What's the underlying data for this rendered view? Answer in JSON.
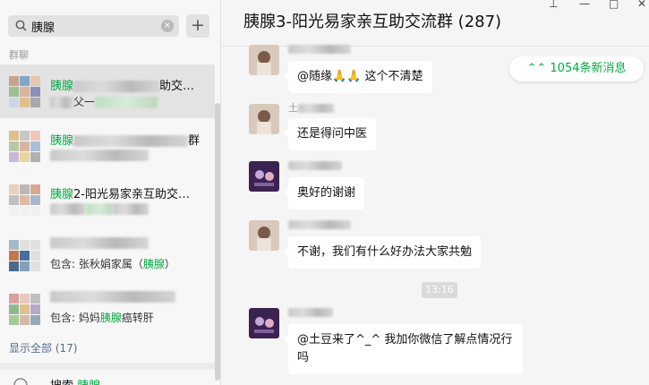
{
  "search": {
    "query": "胰腺",
    "clear_symbol": "×",
    "add_symbol": "+"
  },
  "results": {
    "section_label": "群聊",
    "items": [
      {
        "keyword": "胰腺",
        "title_tail": "助交…",
        "sub_text": "父一"
      },
      {
        "keyword": "胰腺",
        "title_tail": "群"
      },
      {
        "keyword": "胰腺",
        "title_tail": "2-阳光易家亲互助交…"
      },
      {
        "sub_prefix": "包含: 张秋娟家属（",
        "sub_keyword": "胰腺",
        "sub_suffix": "）"
      },
      {
        "sub_prefix": "包含: 妈妈",
        "sub_keyword": "胰腺",
        "sub_suffix": "癌转肝"
      }
    ],
    "show_all": "显示全部 (17)",
    "web_search_prefix": "搜索",
    "web_search_keyword": "胰腺"
  },
  "chat": {
    "title": "胰腺3-阳光易家亲互助交流群 (287)",
    "window_controls": [
      "⊥",
      "—",
      "□",
      "✕"
    ],
    "unread_badge": "⌃⌃ 1054条新消息",
    "timestamp": "13:16",
    "messages": [
      {
        "name": "",
        "text": "@随缘🙏🙏 这个不清楚"
      },
      {
        "name": "土",
        "text": "还是得问中医"
      },
      {
        "name": "",
        "text": "奥好的谢谢"
      },
      {
        "name": "",
        "text": "不谢，我们有什么好办法大家共勉"
      },
      {
        "name": "",
        "text": "@土豆来了^_^ 我加你微信了解点情况行吗"
      }
    ]
  },
  "colors": {
    "highlight_green": "#07a844",
    "link_blue": "#576b95"
  }
}
